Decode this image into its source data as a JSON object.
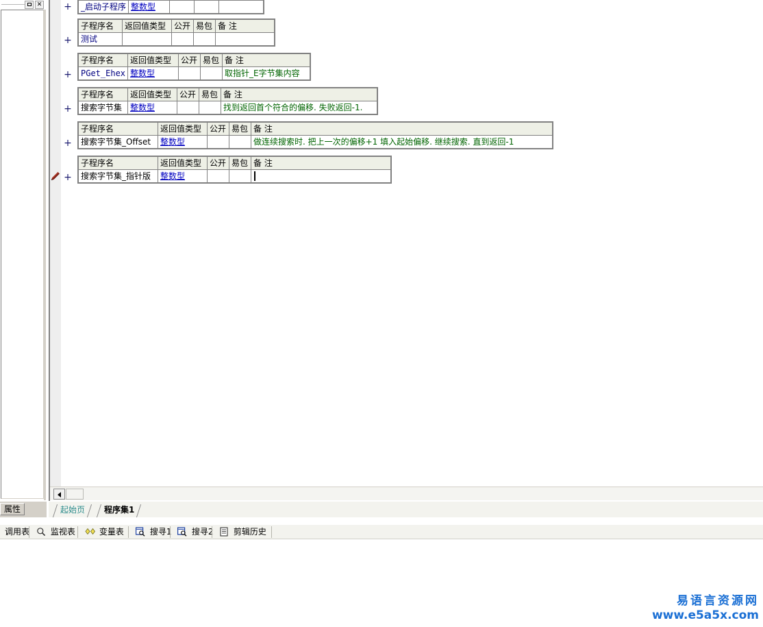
{
  "window": {
    "left_panel": {
      "maximize_label": "",
      "close_label": "✕",
      "properties_tab": "属性"
    }
  },
  "editor": {
    "columns": [
      "子程序名",
      "返回值类型",
      "公开",
      "易包",
      "备 注"
    ],
    "fold_marker": "+",
    "tables": [
      {
        "id": "startup",
        "header_visible": false,
        "name": "_启动子程序",
        "return_type": "整数型",
        "public": "",
        "epack": "",
        "note": ""
      },
      {
        "id": "test",
        "header_visible": true,
        "name": "测试",
        "return_type": "",
        "public": "",
        "epack": "",
        "note": ""
      },
      {
        "id": "pget-ehex",
        "header_visible": true,
        "name": "PGet_Ehex",
        "return_type": "整数型",
        "public": "",
        "epack": "",
        "note": "取指针_E字节集内容"
      },
      {
        "id": "search-bytes",
        "header_visible": true,
        "name": "搜索字节集",
        "return_type": "整数型",
        "public": "",
        "epack": "",
        "note": "找到返回首个符合的偏移. 失败返回-1."
      },
      {
        "id": "search-bytes-offset",
        "header_visible": true,
        "name": "搜索字节集_Offset",
        "return_type": "整数型",
        "public": "",
        "epack": "",
        "note": "做连续搜索时. 把上一次的偏移+1 填入起始偏移. 继续搜索. 直到返回-1"
      },
      {
        "id": "search-bytes-pointer",
        "header_visible": true,
        "name": "搜索字节集_指针版",
        "return_type": "整数型",
        "public": "",
        "epack": "",
        "note": "",
        "editing": true
      }
    ]
  },
  "doc_tabs": [
    {
      "label": "起始页",
      "active": false
    },
    {
      "label": "程序集1",
      "active": true
    }
  ],
  "bottom_tabs": [
    {
      "label": "调用表",
      "icon": "none"
    },
    {
      "label": "监视表",
      "icon": "magnifier-icon"
    },
    {
      "label": "变量表",
      "icon": "diamonds-icon"
    },
    {
      "label": "搜寻1",
      "icon": "find-window-icon"
    },
    {
      "label": "搜寻2",
      "icon": "find-window-icon"
    },
    {
      "label": "剪辑历史",
      "icon": "clipboard-icon"
    }
  ],
  "watermark": {
    "cn": "易语言资源网",
    "url": "www.e5a5x.com"
  },
  "colors": {
    "header_bg": "#eef0e6",
    "name_text": "#000080",
    "type_text": "#0000c0",
    "note_text": "#006400",
    "fold_marker": "#1a1a6e",
    "tab_inactive": "#2d8c8c",
    "watermark": "#1a6fd4"
  }
}
